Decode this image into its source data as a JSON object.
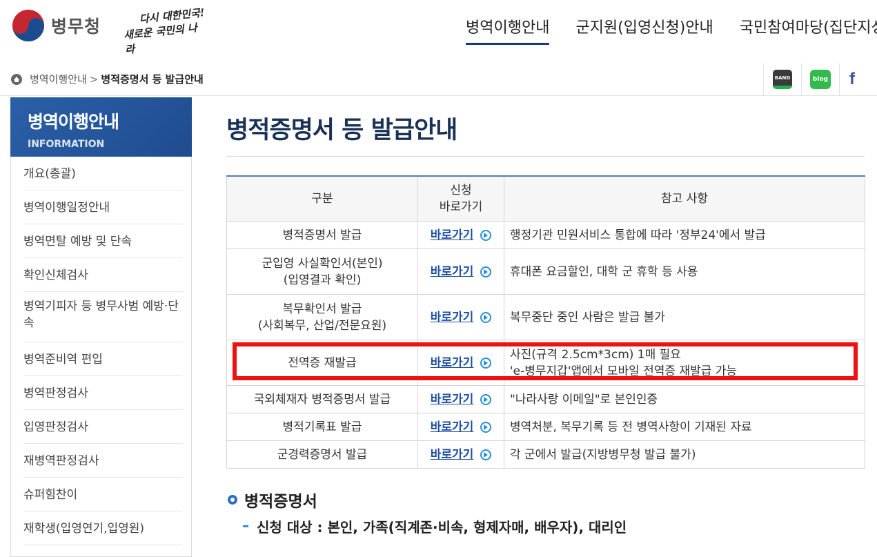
{
  "header": {
    "logo_text": "병무청",
    "slogan_line1": "다시 대한민국!",
    "slogan_line2": "새로운 국민의 나라",
    "nav": [
      {
        "label": "병역이행안내",
        "active": true
      },
      {
        "label": "군지원(입영신청)안내",
        "active": false
      },
      {
        "label": "국민참여마당(집단지성",
        "active": false
      }
    ]
  },
  "breadcrumb": {
    "parent": "병역이행안내",
    "separator": ">",
    "current": "병적증명서 등 발급안내"
  },
  "sns": {
    "band_label": "BAND",
    "blog_label": "blog",
    "facebook_label": "f"
  },
  "sidebar": {
    "title": "병역이행안내",
    "subtitle": "INFORMATION",
    "items": [
      "개요(총괄)",
      "병역이행일정안내",
      "병역면탈 예방 및 단속",
      "확인신체검사",
      "병역기피자 등 병무사범 예방·단속",
      "병역준비역 편입",
      "병역판정검사",
      "입영판정검사",
      "재병역판정검사",
      "슈퍼힘찬이",
      "재학생(입영연기,입영원)"
    ]
  },
  "main": {
    "title": "병적증명서 등 발급안내",
    "table": {
      "headers": [
        "구분",
        "신청 바로가기",
        "참고 사항"
      ],
      "link_label": "바로가기",
      "rows": [
        {
          "category": [
            "병적증명서 발급"
          ],
          "note": [
            "행정기관 민원서비스 통합에 따라 '정부24'에서 발급"
          ]
        },
        {
          "category": [
            "군입영 사실확인서(본인)",
            "(입영결과 확인)"
          ],
          "note": [
            "휴대폰 요금할인, 대학 군 휴학 등 사용"
          ]
        },
        {
          "category": [
            "복무확인서 발급",
            "(사회복무, 산업/전문요원)"
          ],
          "note": [
            "복무중단 중인 사람은 발급 불가"
          ]
        },
        {
          "category": [
            "전역증 재발급"
          ],
          "note": [
            "사진(규격 2.5cm*3cm) 1매 필요",
            "'e-병무지갑'앱에서 모바일 전역증 재발급 가능"
          ]
        },
        {
          "category": [
            "국외체재자 병적증명서 발급"
          ],
          "note": [
            "\"나라사랑 이메일\"로 본인인증"
          ]
        },
        {
          "category": [
            "병적기록표 발급"
          ],
          "note": [
            "병역처분, 복무기록 등 전 병역사항이 기재된 자료"
          ]
        },
        {
          "category": [
            "군경력증명서 발급"
          ],
          "note": [
            "각 군에서 발급(지방병무청 발급 불가)"
          ]
        }
      ]
    },
    "section_heading": "병적증명서",
    "section_sub": "신청 대상 : 본인, 가족(직계존·비속, 형제자매, 배우자), 대리인"
  },
  "colors": {
    "accent_navy": "#1a3156",
    "sidebar_blue": "#2b5fa8",
    "link_blue": "#1d4fa3",
    "highlight_red": "#ee1111"
  }
}
